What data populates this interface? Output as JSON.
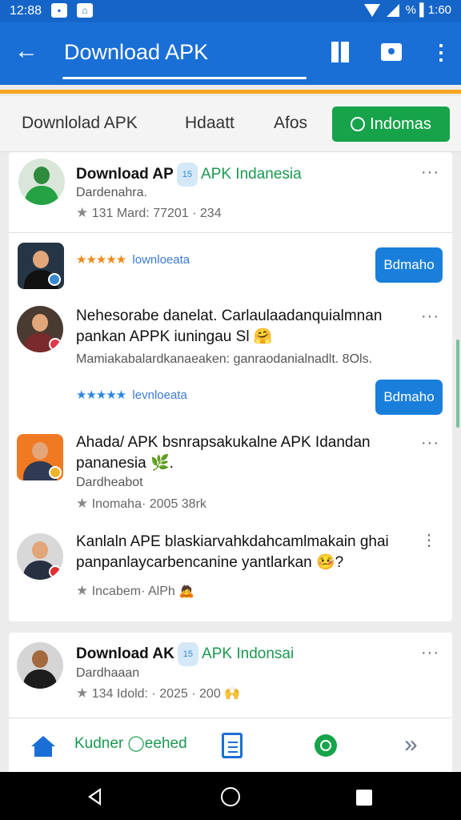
{
  "status_bar": {
    "time": "12:88",
    "battery_text": "% ▌1:60"
  },
  "app_bar": {
    "back_icon": "arrow-left-icon",
    "title": "Download APK"
  },
  "tabs": [
    {
      "label": "Downlolad APK"
    },
    {
      "label": "Hdaatt"
    },
    {
      "label": "Afos"
    },
    {
      "label": "Indomas",
      "active": true
    }
  ],
  "items": [
    {
      "title_bold": "Download AP",
      "tag": "15",
      "title_green": "APK Indanesia",
      "sub": "Dardenahra.",
      "meta": "131 Mard: 77201 · 234"
    },
    {
      "rating": "★★★★★",
      "download_label": "lownloeata",
      "button_label": "Bdmaho"
    },
    {
      "title": "Nehesorabe danelat. Carlaulaadanquialmnan pankan APPK iuningau Sl 🤗",
      "sub": "Mamiakabalardkanaeaken: ganraodanialnadlt. 8Ols.",
      "rating": "★★★★★",
      "download_label": "levnloeata",
      "button_label": "Bdmaho"
    },
    {
      "title": "Ahada/ APK bsnrapsakukalne APK Idandan pananesia 🌿.",
      "sub": "Dardheabot",
      "meta": "Inomaha· 2005 38rk"
    },
    {
      "title": "Kanlaln APE blaskiarvahkdahcamlmakain ghai panpanlaycarbencanine yantlarkan 🤒?",
      "meta": "Incabem· AlPh 🙇"
    },
    {
      "title_bold": "Download AK",
      "tag": "15",
      "title_green": "APK Indonsai",
      "sub": "Dardhaaan",
      "meta": "134 Idold: · 2025 · 200 🙌"
    }
  ],
  "bottom_nav": {
    "label": "Kudner ◯eehed",
    "forward_icon": "double-chevron-right-icon"
  },
  "colors": {
    "primary": "#1a6fd6",
    "accent": "#17a34a",
    "orange": "#f5a623"
  }
}
